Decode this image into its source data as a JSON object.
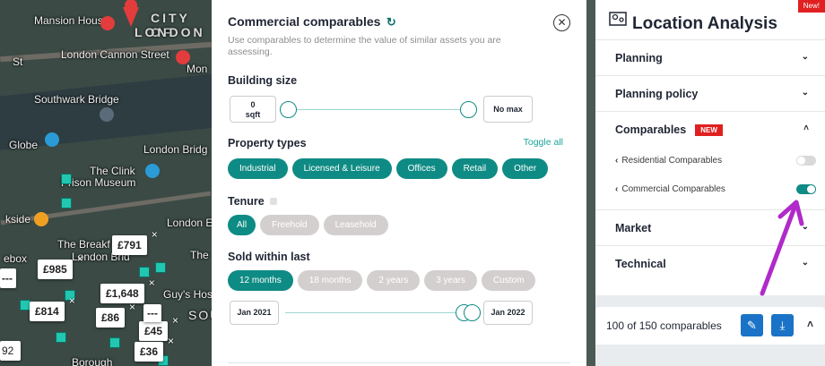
{
  "map": {
    "labels": {
      "mansion_house": "Mansion House",
      "city_of": "CITY OF",
      "london_big": "LONDON",
      "cannon_street": "London Cannon Street",
      "mon": "Mon",
      "st": "St",
      "southwark_bridge": "Southwark Bridge",
      "globe": "Globe",
      "london_bridge": "London Bridg",
      "the_clink": "The Clink",
      "prison_museum": "Prison Museum",
      "side": "kside",
      "london_b2": "London E",
      "the_breakf": "The Breakf",
      "london_brid2": "London Brid",
      "ebox": "ebox",
      "the_right": "The",
      "guys": "Guy's Hos",
      "sou": "SOU",
      "borough": "Borough"
    },
    "price_tags": [
      {
        "label": "£791"
      },
      {
        "label": "£985"
      },
      {
        "label": "£1,648"
      },
      {
        "label": "£814"
      },
      {
        "label": "£86"
      },
      {
        "label": "£45"
      },
      {
        "label": "£36"
      }
    ],
    "misc": {
      "x_glyph": "×",
      "dash_a": "---",
      "dash_b": "---",
      "num92": "92"
    }
  },
  "panel": {
    "title": "Commercial comparables",
    "subtitle": "Use comparables to determine the value of similar assets you are assessing.",
    "building_size": {
      "title": "Building size",
      "min_value": "0",
      "min_unit": "sqft",
      "max_value": "No max"
    },
    "property_types": {
      "title": "Property types",
      "toggle_all": "Toggle all",
      "options": [
        "Industrial",
        "Licensed & Leisure",
        "Offices",
        "Retail",
        "Other"
      ]
    },
    "tenure": {
      "title": "Tenure",
      "options": [
        "All",
        "Freehold",
        "Leasehold"
      ],
      "selected": "All"
    },
    "sold_within": {
      "title": "Sold within last",
      "options": [
        "12 months",
        "18 months",
        "2 years",
        "3 years",
        "Custom"
      ],
      "selected": "12 months",
      "date_from": "Jan 2021",
      "date_to": "Jan 2022"
    }
  },
  "sidebar": {
    "title": "Location Analysis",
    "new_flag": "New!",
    "items": [
      {
        "label": "Planning"
      },
      {
        "label": "Planning policy"
      },
      {
        "label": "Comparables",
        "badge": "NEW"
      },
      {
        "label": "Market"
      },
      {
        "label": "Technical"
      }
    ],
    "sub_items": [
      {
        "label": "Residential Comparables",
        "enabled": false
      },
      {
        "label": "Commercial Comparables",
        "enabled": true
      }
    ]
  },
  "footer": {
    "count_text": "100 of 150 comparables"
  },
  "colors": {
    "accent": "#0e8b84",
    "badge_red": "#e02020",
    "annotation_arrow": "#b02ac9",
    "button_blue": "#1a73c6"
  }
}
